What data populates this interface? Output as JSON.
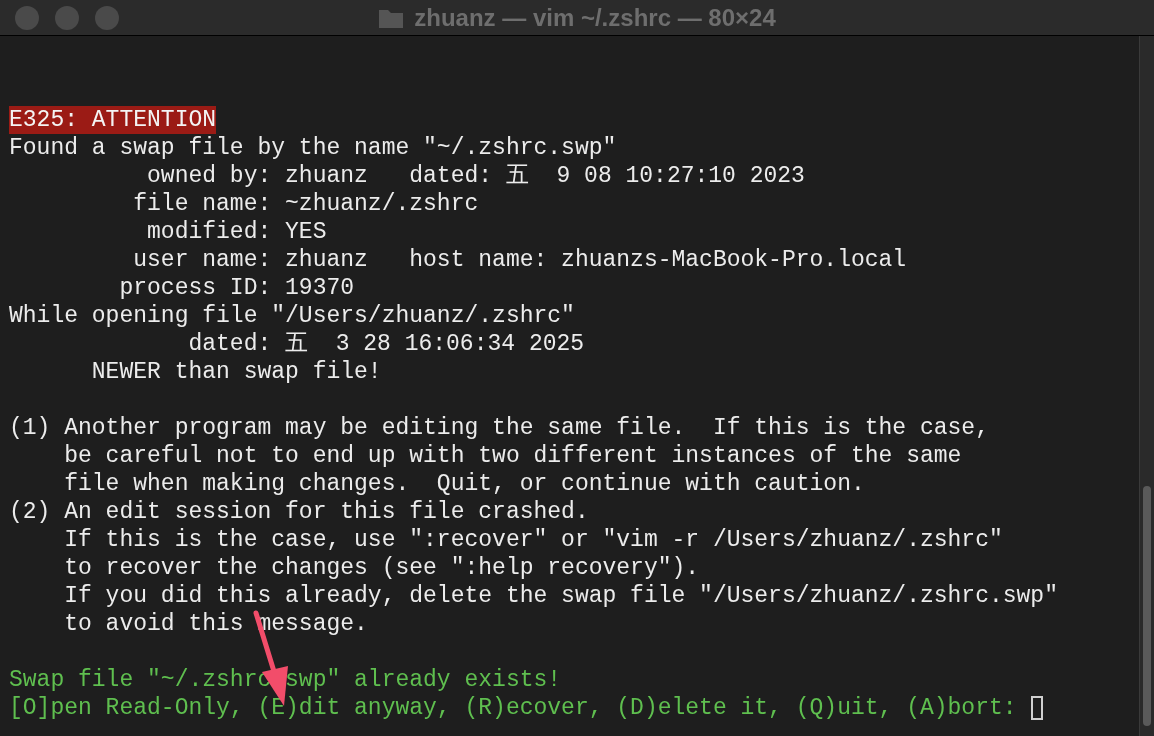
{
  "window": {
    "title": "zhuanz — vim ~/.zshrc — 80×24"
  },
  "terminal": {
    "lines": [
      {
        "kind": "blank"
      },
      {
        "kind": "blank"
      },
      {
        "kind": "error",
        "text": "E325: ATTENTION"
      },
      {
        "kind": "normal",
        "text": "Found a swap file by the name \"~/.zshrc.swp\""
      },
      {
        "kind": "normal",
        "text": "          owned by: zhuanz   dated: 五  9 08 10:27:10 2023"
      },
      {
        "kind": "normal",
        "text": "         file name: ~zhuanz/.zshrc"
      },
      {
        "kind": "normal",
        "text": "          modified: YES"
      },
      {
        "kind": "normal",
        "text": "         user name: zhuanz   host name: zhuanzs-MacBook-Pro.local"
      },
      {
        "kind": "normal",
        "text": "        process ID: 19370"
      },
      {
        "kind": "normal",
        "text": "While opening file \"/Users/zhuanz/.zshrc\""
      },
      {
        "kind": "normal",
        "text": "             dated: 五  3 28 16:06:34 2025"
      },
      {
        "kind": "normal",
        "text": "      NEWER than swap file!"
      },
      {
        "kind": "blank"
      },
      {
        "kind": "normal",
        "text": "(1) Another program may be editing the same file.  If this is the case,"
      },
      {
        "kind": "normal",
        "text": "    be careful not to end up with two different instances of the same"
      },
      {
        "kind": "normal",
        "text": "    file when making changes.  Quit, or continue with caution."
      },
      {
        "kind": "normal",
        "text": "(2) An edit session for this file crashed."
      },
      {
        "kind": "normal",
        "text": "    If this is the case, use \":recover\" or \"vim -r /Users/zhuanz/.zshrc\""
      },
      {
        "kind": "normal",
        "text": "    to recover the changes (see \":help recovery\")."
      },
      {
        "kind": "normal",
        "text": "    If you did this already, delete the swap file \"/Users/zhuanz/.zshrc.swp\""
      },
      {
        "kind": "normal",
        "text": "    to avoid this message."
      },
      {
        "kind": "blank"
      },
      {
        "kind": "prompt",
        "text": "Swap file \"~/.zshrc.swp\" already exists!"
      },
      {
        "kind": "prompt",
        "text": "[O]pen Read-Only, (E)dit anyway, (R)ecover, (D)elete it, (Q)uit, (A)bort:",
        "cursor": true
      }
    ]
  }
}
